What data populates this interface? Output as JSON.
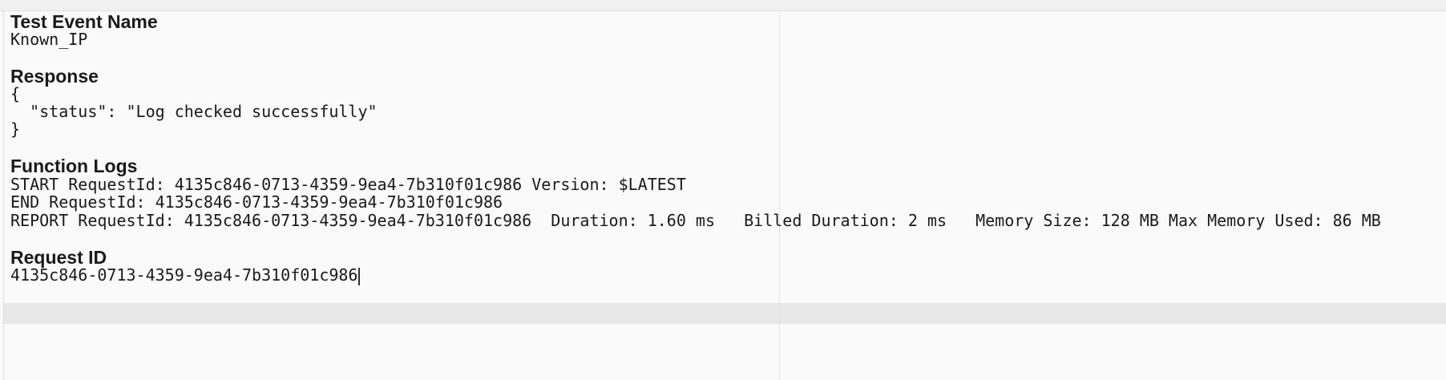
{
  "sections": {
    "test_event": {
      "heading": "Test Event Name",
      "value": "Known_IP"
    },
    "response": {
      "heading": "Response",
      "lines": [
        "{",
        "  \"status\": \"Log checked successfully\"",
        "}"
      ]
    },
    "function_logs": {
      "heading": "Function Logs",
      "lines": [
        "START RequestId: 4135c846-0713-4359-9ea4-7b310f01c986 Version: $LATEST",
        "END RequestId: 4135c846-0713-4359-9ea4-7b310f01c986",
        "REPORT RequestId: 4135c846-0713-4359-9ea4-7b310f01c986  Duration: 1.60 ms   Billed Duration: 2 ms   Memory Size: 128 MB Max Memory Used: 86 MB"
      ]
    },
    "request_id": {
      "heading": "Request ID",
      "value": "4135c846-0713-4359-9ea4-7b310f01c986"
    }
  }
}
